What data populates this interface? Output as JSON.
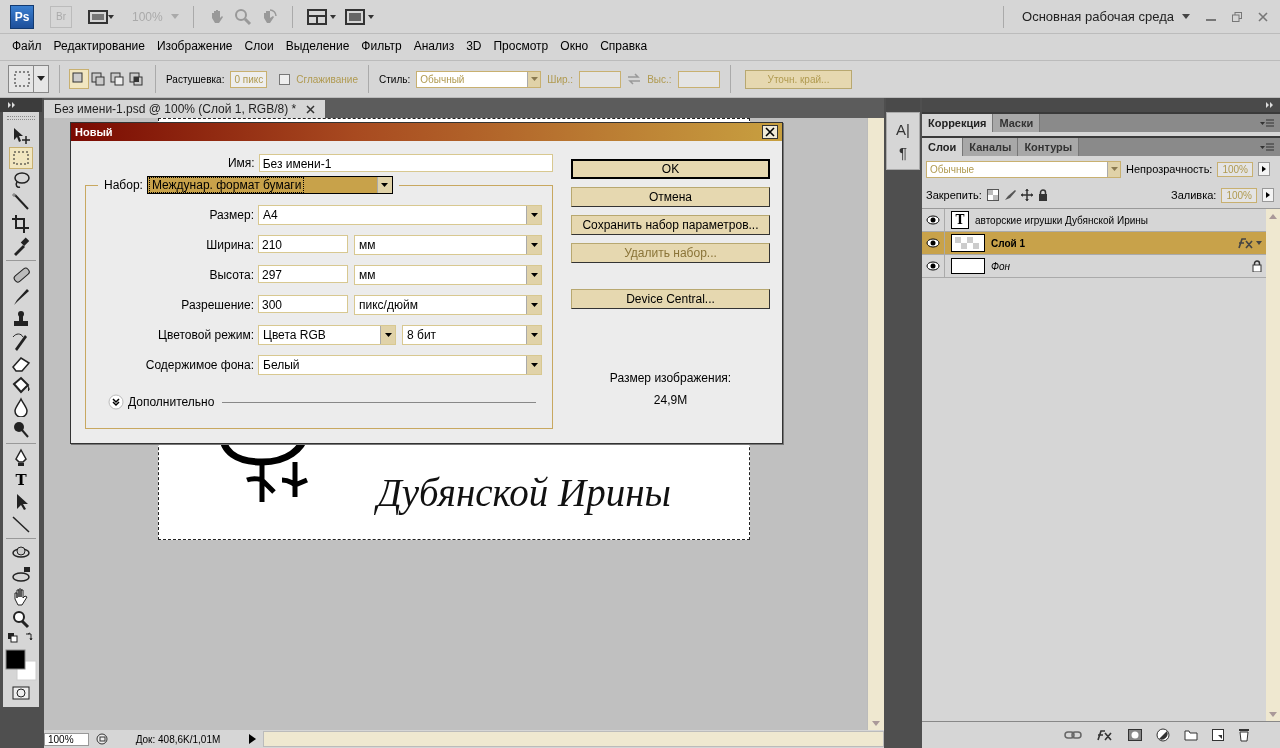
{
  "app_bar": {
    "logo": "Ps",
    "bridge": "Br",
    "zoom": "100%",
    "workspace": "Основная рабочая среда"
  },
  "menu": [
    "Файл",
    "Редактирование",
    "Изображение",
    "Слои",
    "Выделение",
    "Фильтр",
    "Анализ",
    "3D",
    "Просмотр",
    "Окно",
    "Справка"
  ],
  "options_bar": {
    "selection_modes": [
      {
        "selected": true
      },
      {
        "selected": false
      },
      {
        "selected": false
      },
      {
        "selected": false
      }
    ],
    "feather_label": "Растушевка:",
    "feather_value": "0 пикс",
    "antialias": {
      "label": "Сглаживание",
      "checked": false
    },
    "style_label": "Стиль:",
    "style_value": "Обычный",
    "width_label": "Шир.:",
    "height_label": "Выс.:",
    "refine_button": "Уточн. край..."
  },
  "tools": {
    "type_glyph": "T"
  },
  "document": {
    "tab_title": "Без имени-1.psd @ 100% (Слой 1, RGB/8) *",
    "canvas_text": "Дубянской Ирины",
    "zoom": "100%",
    "doc_info": "Док: 408,6K/1,01M"
  },
  "dialog": {
    "title": "Новый",
    "name_label": "Имя:",
    "name_value": "Без имени-1",
    "preset_label": "Набор:",
    "preset_value": "Междунар. формат бумаги",
    "rows": [
      {
        "label": "Размер:",
        "controls": [
          {
            "kind": "select",
            "value": "A4"
          }
        ]
      },
      {
        "label": "Ширина:",
        "controls": [
          {
            "kind": "input",
            "value": "210"
          },
          {
            "kind": "select",
            "value": "мм"
          }
        ]
      },
      {
        "label": "Высота:",
        "controls": [
          {
            "kind": "input",
            "value": "297"
          },
          {
            "kind": "select",
            "value": "мм"
          }
        ]
      },
      {
        "label": "Разрешение:",
        "controls": [
          {
            "kind": "input",
            "value": "300"
          },
          {
            "kind": "select",
            "value": "пикс/дюйм"
          }
        ]
      },
      {
        "label": "Цветовой режим:",
        "controls": [
          {
            "kind": "select",
            "value": "Цвета RGB"
          },
          {
            "kind": "select",
            "value": "8 бит"
          }
        ]
      },
      {
        "label": "Содержимое фона:",
        "controls": [
          {
            "kind": "select",
            "value": "Белый"
          }
        ]
      }
    ],
    "advanced_label": "Дополнительно",
    "buttons": [
      {
        "label": "OK",
        "default": true,
        "disabled": false
      },
      {
        "label": "Отмена",
        "default": false,
        "disabled": false
      },
      {
        "label": "Сохранить набор параметров...",
        "default": false,
        "disabled": false
      },
      {
        "label": "Удалить набор...",
        "default": false,
        "disabled": true
      },
      {
        "label": "Device Central...",
        "default": false,
        "disabled": false
      }
    ],
    "size_label": "Размер изображения:",
    "size_value": "24,9M"
  },
  "mini_panel": [
    "A|",
    "¶"
  ],
  "panels": {
    "top_tabs": [
      {
        "label": "Коррекция",
        "selected": true
      },
      {
        "label": "Маски",
        "selected": false
      }
    ],
    "layer_tabs": [
      {
        "label": "Слои",
        "selected": true
      },
      {
        "label": "Каналы",
        "selected": false
      },
      {
        "label": "Контуры",
        "selected": false
      }
    ],
    "blend_mode": "Обычные",
    "opacity_label": "Непрозрачность:",
    "opacity_value": "100%",
    "lock_label": "Закрепить:",
    "fill_label": "Заливка:",
    "fill_value": "100%",
    "layers": [
      {
        "name": "авторские  игрушки Дубянской Ирины",
        "kind": "text",
        "glyph": "T",
        "selected": false,
        "fx": false,
        "locked": false
      },
      {
        "name": "Слой 1",
        "kind": "pixel",
        "selected": true,
        "fx": true,
        "locked": false
      },
      {
        "name": "Фон",
        "kind": "background",
        "selected": false,
        "fx": false,
        "locked": true
      }
    ]
  }
}
